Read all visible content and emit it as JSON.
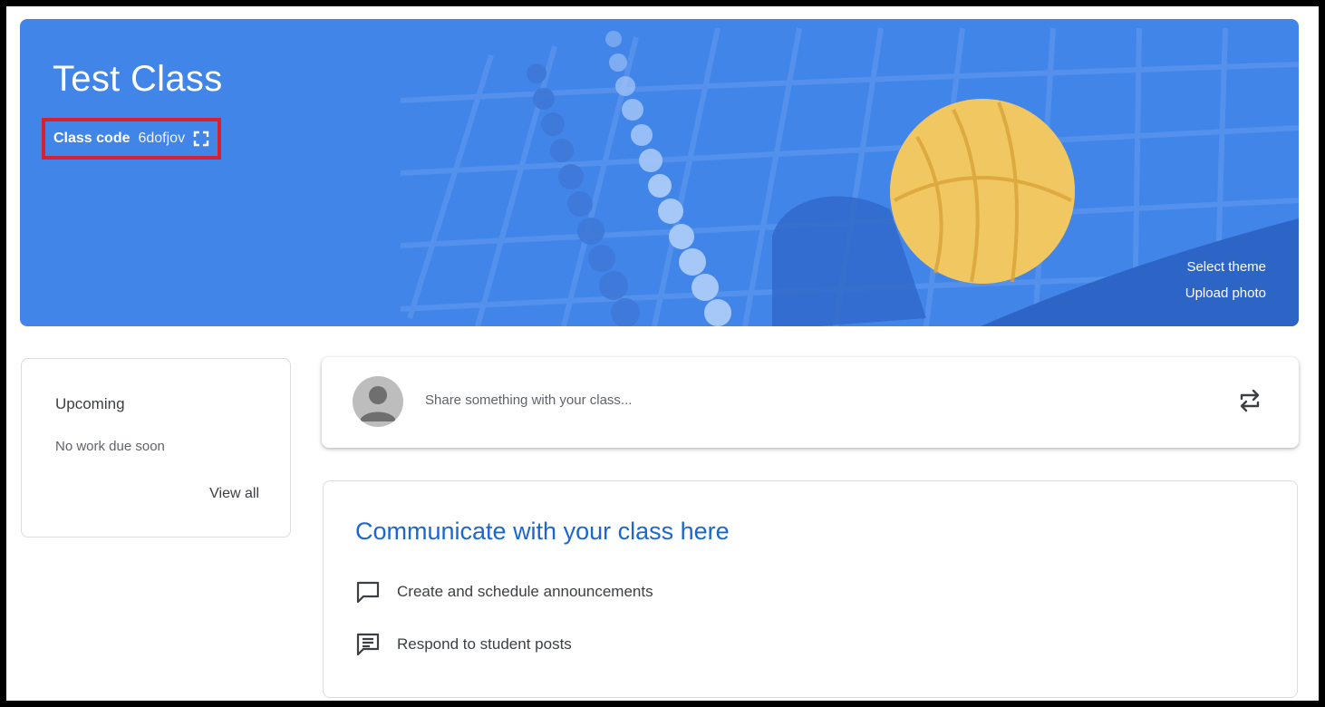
{
  "banner": {
    "title": "Test Class",
    "class_code_label": "Class code",
    "class_code_value": "6dofjov",
    "select_theme": "Select theme",
    "upload_photo": "Upload photo",
    "color": "#4285e8",
    "highlight_color": "#d9202f"
  },
  "upcoming": {
    "title": "Upcoming",
    "subtitle": "No work due soon",
    "view_all": "View all"
  },
  "share": {
    "placeholder": "Share something with your class..."
  },
  "communicate": {
    "title": "Communicate with your class here",
    "items": [
      {
        "label": "Create and schedule announcements",
        "icon": "announcement-icon"
      },
      {
        "label": "Respond to student posts",
        "icon": "comment-icon"
      }
    ]
  },
  "icons": [
    "expand-icon",
    "avatar",
    "repost-icon",
    "announcement-icon",
    "comment-icon"
  ]
}
